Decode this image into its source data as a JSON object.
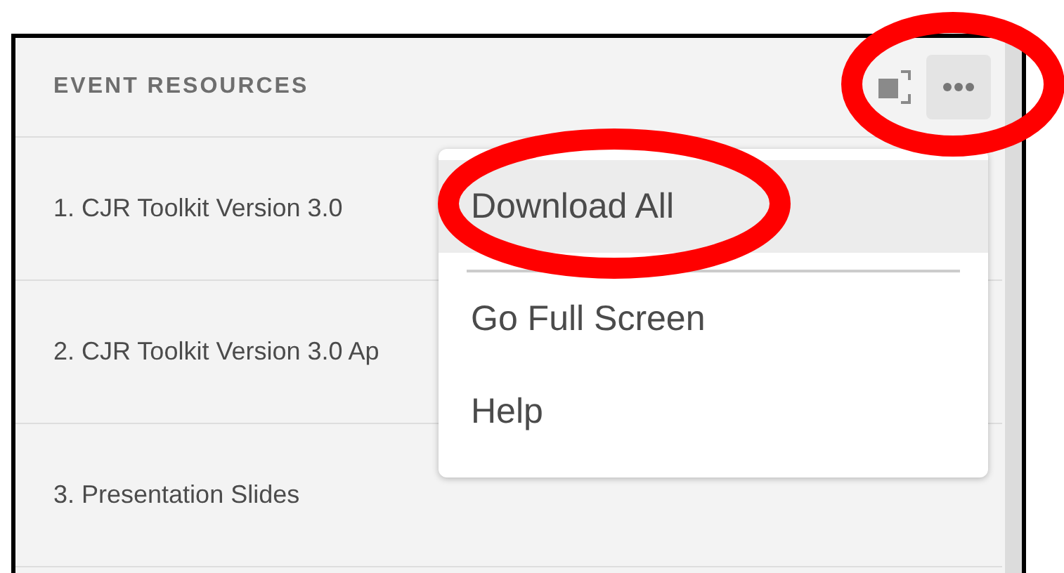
{
  "panel": {
    "title": "EVENT RESOURCES"
  },
  "resources": [
    {
      "label": "1. CJR Toolkit Version 3.0"
    },
    {
      "label": "2. CJR Toolkit Version 3.0 Ap"
    },
    {
      "label": "3. Presentation Slides"
    }
  ],
  "menu": {
    "items": [
      {
        "label": "Download All",
        "selected": true
      },
      {
        "label": "Go Full Screen",
        "selected": false
      },
      {
        "label": "Help",
        "selected": false
      }
    ]
  },
  "annotations": [
    {
      "kind": "ellipse"
    },
    {
      "kind": "ellipse"
    }
  ]
}
